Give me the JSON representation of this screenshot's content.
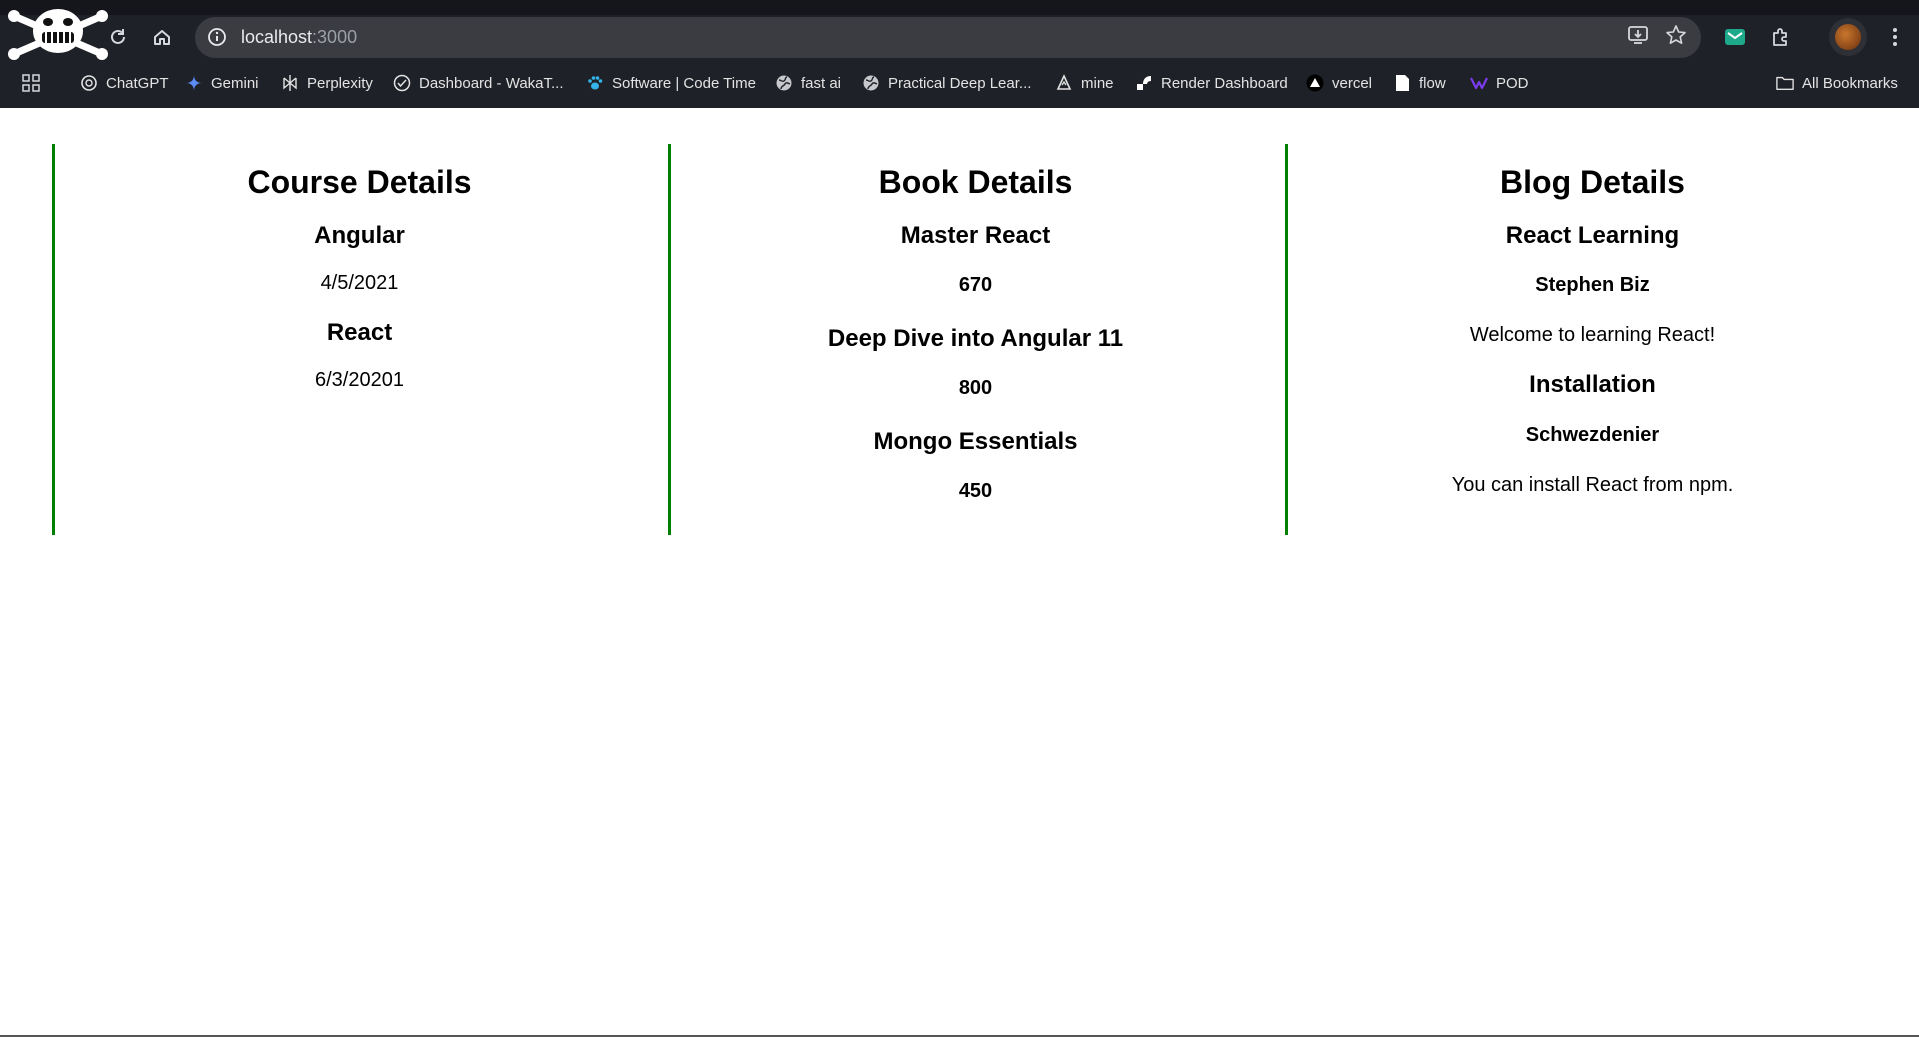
{
  "browser": {
    "url_host": "localhost",
    "url_port": ":3000",
    "bookmarks": [
      {
        "label": "ChatGPT",
        "icon": "chatgpt-icon"
      },
      {
        "label": "Gemini",
        "icon": "gemini-icon"
      },
      {
        "label": "Perplexity",
        "icon": "perplexity-icon"
      },
      {
        "label": "Dashboard - WakaT...",
        "icon": "wakatime-icon"
      },
      {
        "label": "Software | Code Time",
        "icon": "paw-icon"
      },
      {
        "label": "fast ai",
        "icon": "globe-icon"
      },
      {
        "label": "Practical Deep Lear...",
        "icon": "globe-icon"
      },
      {
        "label": "mine",
        "icon": "mine-icon"
      },
      {
        "label": "Render Dashboard",
        "icon": "render-icon"
      },
      {
        "label": "vercel",
        "icon": "vercel-icon"
      },
      {
        "label": "flow",
        "icon": "flow-icon"
      },
      {
        "label": "POD",
        "icon": "pod-icon"
      }
    ],
    "all_bookmarks": "All Bookmarks"
  },
  "course": {
    "heading": "Course Details",
    "items": [
      {
        "name": "Angular",
        "date": "4/5/2021"
      },
      {
        "name": "React",
        "date": "6/3/20201"
      }
    ]
  },
  "book": {
    "heading": "Book Details",
    "items": [
      {
        "name": "Master React",
        "price": "670"
      },
      {
        "name": "Deep Dive into Angular 11",
        "price": "800"
      },
      {
        "name": "Mongo Essentials",
        "price": "450"
      }
    ]
  },
  "blog": {
    "heading": "Blog Details",
    "items": [
      {
        "title": "React Learning",
        "author": "Stephen Biz",
        "text": "Welcome to learning React!"
      },
      {
        "title": "Installation",
        "author": "Schwezdenier",
        "text": "You can install React from npm."
      }
    ]
  },
  "colors": {
    "divider": "#008000",
    "chrome_bg": "#1f2128",
    "omnibox_bg": "#3a3c42"
  }
}
